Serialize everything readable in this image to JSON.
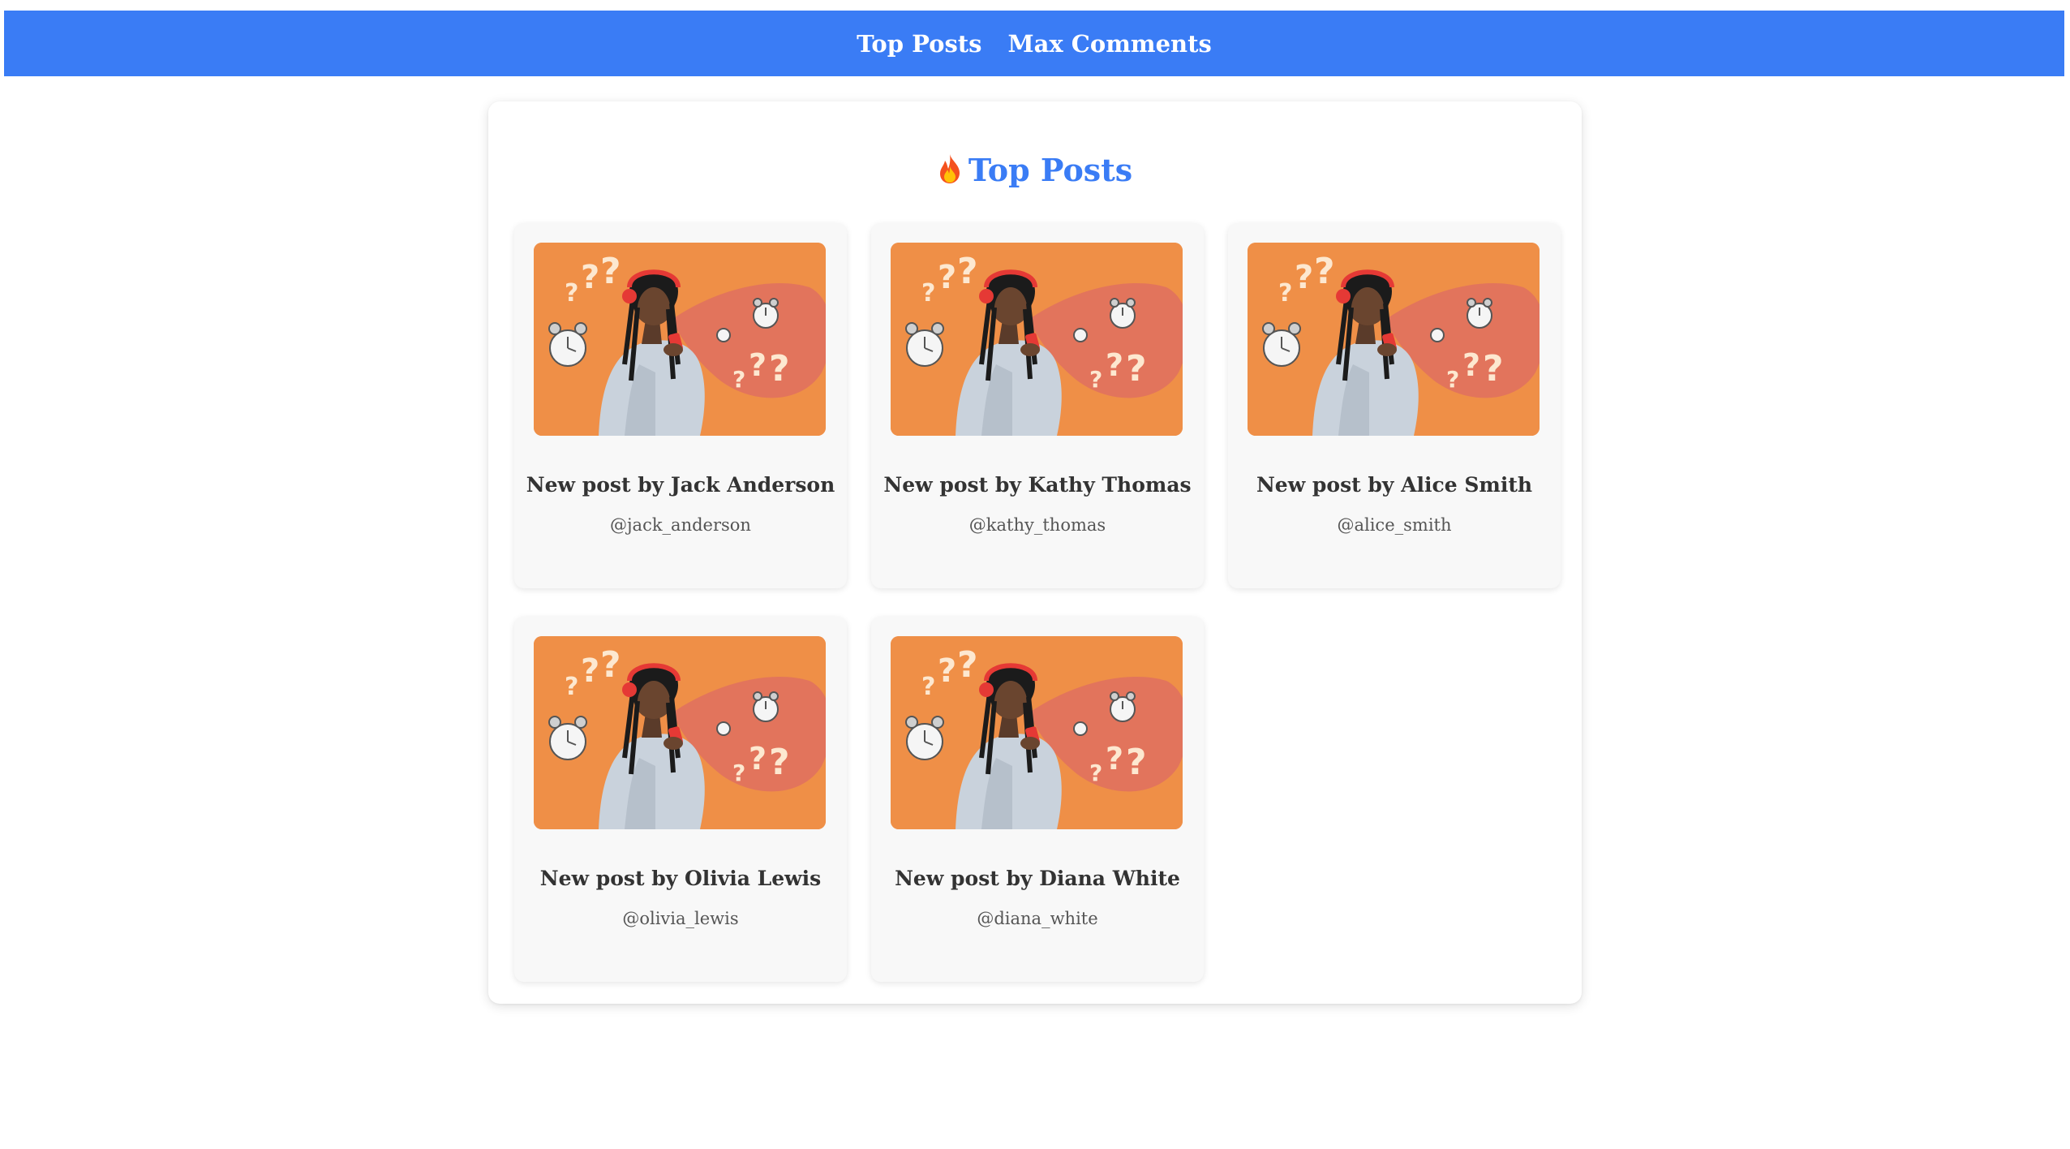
{
  "nav": {
    "links": [
      {
        "label": "Top Posts"
      },
      {
        "label": "Max Comments"
      }
    ]
  },
  "page": {
    "title": "Top Posts",
    "title_icon": "fire-emoji"
  },
  "posts": [
    {
      "title": "New post by Jack Anderson",
      "handle": "@jack_anderson"
    },
    {
      "title": "New post by Kathy Thomas",
      "handle": "@kathy_thomas"
    },
    {
      "title": "New post by Alice Smith",
      "handle": "@alice_smith"
    },
    {
      "title": "New post by Olivia Lewis",
      "handle": "@olivia_lewis"
    },
    {
      "title": "New post by Diana White",
      "handle": "@diana_white"
    }
  ],
  "colors": {
    "nav_background": "#3a7cf5",
    "title_color": "#3a7cf5",
    "thumbnail_orange": "#ef8f47",
    "thumbnail_blob": "#e2745c"
  }
}
